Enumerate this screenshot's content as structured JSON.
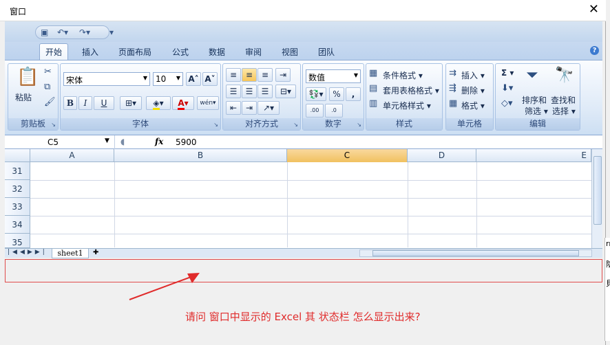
{
  "window": {
    "title": "窗口",
    "close": "✕"
  },
  "qat": {
    "save_icon": "save-icon",
    "undo_icon": "undo-icon",
    "redo_icon": "redo-icon"
  },
  "tabs": [
    "开始",
    "插入",
    "页面布局",
    "公式",
    "数据",
    "审阅",
    "视图",
    "团队"
  ],
  "ribbon": {
    "clipboard": {
      "paste": "粘贴",
      "label": "剪贴板"
    },
    "font": {
      "name": "宋体",
      "size": "10",
      "bold": "B",
      "italic": "I",
      "underline": "U",
      "label": "字体",
      "grow": "A",
      "color_a": "A",
      "pinyin": "wén"
    },
    "alignment": {
      "label": "对齐方式"
    },
    "number": {
      "format": "数值",
      "percent": "%",
      "comma": ",",
      "inc": ".00",
      "dec": ".0",
      "label": "数字"
    },
    "styles": {
      "cond": "条件格式",
      "table": "套用表格格式",
      "cell": "单元格样式",
      "label": "样式"
    },
    "cells": {
      "insert": "插入",
      "delete": "删除",
      "format": "格式",
      "label": "单元格"
    },
    "editing": {
      "sum": "Σ",
      "sort": "排序和",
      "sort2": "筛选",
      "find": "查找和",
      "find2": "选择",
      "label": "编辑"
    }
  },
  "formula_bar": {
    "name_box": "C5",
    "fx": "fx",
    "value": "5900"
  },
  "columns": [
    "A",
    "B",
    "C",
    "D",
    "E"
  ],
  "selected_column": "C",
  "rows": [
    "31",
    "32",
    "33",
    "34",
    "35"
  ],
  "sheet_tab": "sheet1",
  "annotation": "请问 窗口中显示的 Excel 其 状态栏 怎么显示出来?",
  "side_chars": [
    "rr",
    "陰",
    "貝"
  ]
}
